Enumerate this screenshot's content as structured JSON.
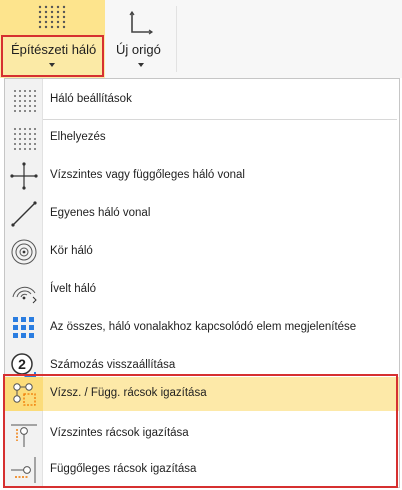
{
  "ribbon": {
    "grid_button_label": "Építészeti háló",
    "origin_button_label": "Új origó",
    "grid_icon": "dot-grid-icon",
    "origin_icon": "axis-corner-icon"
  },
  "menu": {
    "items": [
      {
        "label": "Háló beállítások",
        "icon": "dot-grid-icon"
      },
      {
        "label": "Elhelyezés",
        "icon": "dot-grid-icon"
      },
      {
        "label": "Vízszintes vagy függőleges háló vonal",
        "icon": "crosshair-icon"
      },
      {
        "label": "Egyenes háló vonal",
        "icon": "diagonal-line-icon"
      },
      {
        "label": "Kör háló",
        "icon": "concentric-circles-icon"
      },
      {
        "label": "Ívelt háló",
        "icon": "arc-grid-icon"
      },
      {
        "label": "Az összes, háló vonalakhoz kapcsolódó elem megjelenítése",
        "icon": "blue-squares-icon"
      },
      {
        "label": "Számozás visszaállítása",
        "icon": "renumber-icon"
      },
      {
        "label": "Vízsz. / Függ. rácsok igazítása",
        "icon": "align-grids-icon"
      },
      {
        "label": "Vízszintes rácsok igazítása",
        "icon": "align-horizontal-grids-icon"
      },
      {
        "label": "Függőleges rácsok igazítása",
        "icon": "align-vertical-grids-icon"
      }
    ],
    "highlighted_index": 8
  },
  "colors": {
    "highlight": "#fde9a8",
    "red_frame": "#d63030",
    "accent_blue": "#2a7de1"
  }
}
